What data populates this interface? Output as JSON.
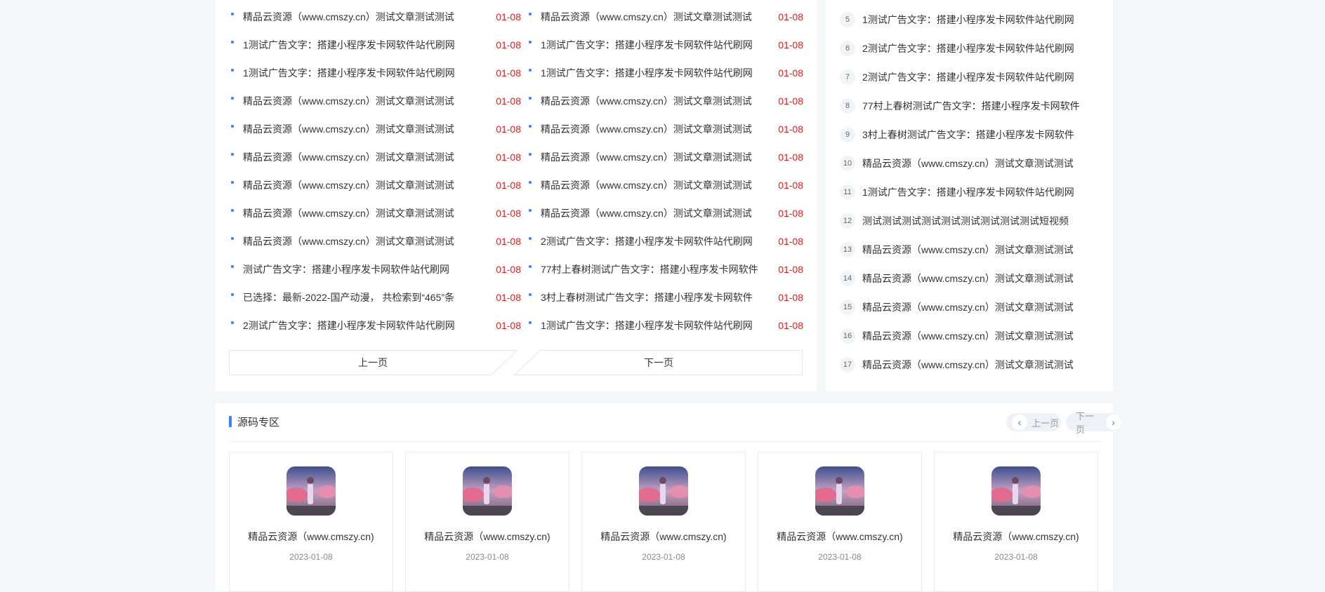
{
  "articles": [
    {
      "title": "精品云资源（www.cmszy.cn）测试文章测试测试",
      "date": "01-08"
    },
    {
      "title": "精品云资源（www.cmszy.cn）测试文章测试测试",
      "date": "01-08"
    },
    {
      "title": "1测试广告文字：搭建小程序发卡网软件站代刷网",
      "date": "01-08"
    },
    {
      "title": "1测试广告文字：搭建小程序发卡网软件站代刷网",
      "date": "01-08"
    },
    {
      "title": "1测试广告文字：搭建小程序发卡网软件站代刷网",
      "date": "01-08"
    },
    {
      "title": "1测试广告文字：搭建小程序发卡网软件站代刷网",
      "date": "01-08"
    },
    {
      "title": "精品云资源（www.cmszy.cn）测试文章测试测试",
      "date": "01-08"
    },
    {
      "title": "精品云资源（www.cmszy.cn）测试文章测试测试",
      "date": "01-08"
    },
    {
      "title": "精品云资源（www.cmszy.cn）测试文章测试测试",
      "date": "01-08"
    },
    {
      "title": "精品云资源（www.cmszy.cn）测试文章测试测试",
      "date": "01-08"
    },
    {
      "title": "精品云资源（www.cmszy.cn）测试文章测试测试",
      "date": "01-08"
    },
    {
      "title": "精品云资源（www.cmszy.cn）测试文章测试测试",
      "date": "01-08"
    },
    {
      "title": "精品云资源（www.cmszy.cn）测试文章测试测试",
      "date": "01-08"
    },
    {
      "title": "精品云资源（www.cmszy.cn）测试文章测试测试",
      "date": "01-08"
    },
    {
      "title": "精品云资源（www.cmszy.cn）测试文章测试测试",
      "date": "01-08"
    },
    {
      "title": "精品云资源（www.cmszy.cn）测试文章测试测试",
      "date": "01-08"
    },
    {
      "title": "精品云资源（www.cmszy.cn）测试文章测试测试",
      "date": "01-08"
    },
    {
      "title": "2测试广告文字：搭建小程序发卡网软件站代刷网",
      "date": "01-08"
    },
    {
      "title": "测试广告文字：搭建小程序发卡网软件站代刷网",
      "date": "01-08"
    },
    {
      "title": "77村上春树测试广告文字：搭建小程序发卡网软件",
      "date": "01-08"
    },
    {
      "title": "已选择：最新-2022-国产动漫，  共检索到“465”条",
      "date": "01-08"
    },
    {
      "title": "3村上春树测试广告文字：搭建小程序发卡网软件",
      "date": "01-08"
    },
    {
      "title": "2测试广告文字：搭建小程序发卡网软件站代刷网",
      "date": "01-08"
    },
    {
      "title": "1测试广告文字：搭建小程序发卡网软件站代刷网",
      "date": "01-08"
    }
  ],
  "pager": {
    "prev_label": "上一页",
    "next_label": "下一页"
  },
  "ranking": [
    {
      "num": "5",
      "title": "1测试广告文字：搭建小程序发卡网软件站代刷网"
    },
    {
      "num": "6",
      "title": "2测试广告文字：搭建小程序发卡网软件站代刷网"
    },
    {
      "num": "7",
      "title": "2测试广告文字：搭建小程序发卡网软件站代刷网"
    },
    {
      "num": "8",
      "title": "77村上春树测试广告文字：搭建小程序发卡网软件"
    },
    {
      "num": "9",
      "title": "3村上春树测试广告文字：搭建小程序发卡网软件"
    },
    {
      "num": "10",
      "title": "精品云资源（www.cmszy.cn）测试文章测试测试"
    },
    {
      "num": "11",
      "title": "1测试广告文字：搭建小程序发卡网软件站代刷网"
    },
    {
      "num": "12",
      "title": "测试测试测试测试测试测试测试测试测试短视频"
    },
    {
      "num": "13",
      "title": "精品云资源（www.cmszy.cn）测试文章测试测试"
    },
    {
      "num": "14",
      "title": "精品云资源（www.cmszy.cn）测试文章测试测试"
    },
    {
      "num": "15",
      "title": "精品云资源（www.cmszy.cn）测试文章测试测试"
    },
    {
      "num": "16",
      "title": "精品云资源（www.cmszy.cn）测试文章测试测试"
    },
    {
      "num": "17",
      "title": "精品云资源（www.cmszy.cn）测试文章测试测试"
    }
  ],
  "source_section": {
    "title": "源码专区",
    "prev_label": "上一页",
    "next_label": "下一页",
    "cards": [
      {
        "name": "精品云资源（www.cmszy.cn)",
        "date": "2023-01-08"
      },
      {
        "name": "精品云资源（www.cmszy.cn)",
        "date": "2023-01-08"
      },
      {
        "name": "精品云资源（www.cmszy.cn)",
        "date": "2023-01-08"
      },
      {
        "name": "精品云资源（www.cmszy.cn)",
        "date": "2023-01-08"
      },
      {
        "name": "精品云资源（www.cmszy.cn)",
        "date": "2023-01-08"
      }
    ]
  },
  "colors": {
    "accent": "#3b82f6",
    "date_red": "#e21d1d",
    "page_bg": "#f4f6fa"
  },
  "icons": {
    "prev": "chevron-left-icon",
    "next": "chevron-right-icon",
    "thumb": "thumbnail-image"
  }
}
